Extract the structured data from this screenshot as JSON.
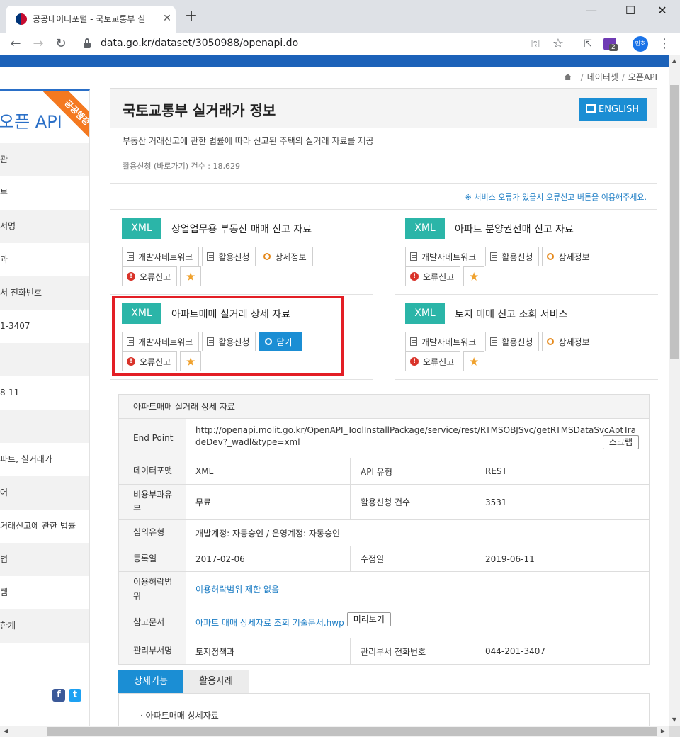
{
  "browser": {
    "tab_title": "공공데이터포털 - 국토교통부 실",
    "url": "data.go.kr/dataset/3050988/openapi.do",
    "extension_badge": "2",
    "profile_label": "민호"
  },
  "breadcrumb": {
    "item1": "데이터셋",
    "item2": "오픈API"
  },
  "sidebar": {
    "title": "오픈 API",
    "ribbon": "공공행정",
    "rows": [
      "관",
      "부",
      "서명",
      "과",
      "서 전화번호",
      "1-3407",
      "",
      "8-11",
      "",
      "파트, 실거래가",
      "어",
      "거래신고에 관한 법률",
      "법",
      "템",
      "한계"
    ]
  },
  "header": {
    "title": "국토교통부 실거래가 정보",
    "english_button": "ENGLISH",
    "description": "부동산 거래신고에 관한 법률에 따라 신고된 주택의 실거래 자료를 제공",
    "usage": "활용신청 (바로가기) 건수 : 18,629",
    "notice": "※ 서비스 오류가 있을시 오류신고 버튼을 이용해주세요."
  },
  "services": [
    {
      "type": "XML",
      "name": "상업업무용 부동산 매매 신고 자료",
      "btn_network": "개발자네트워크",
      "btn_apply": "활용신청",
      "btn_detail": "상세정보",
      "btn_error": "오류신고"
    },
    {
      "type": "XML",
      "name": "아파트 분양권전매 신고 자료",
      "btn_network": "개발자네트워크",
      "btn_apply": "활용신청",
      "btn_detail": "상세정보",
      "btn_error": "오류신고"
    },
    {
      "type": "XML",
      "name": "아파트매매 실거래 상세 자료",
      "btn_network": "개발자네트워크",
      "btn_apply": "활용신청",
      "btn_detail": "닫기",
      "btn_error": "오류신고"
    },
    {
      "type": "XML",
      "name": "토지 매매 신고 조회 서비스",
      "btn_network": "개발자네트워크",
      "btn_apply": "활용신청",
      "btn_detail": "상세정보",
      "btn_error": "오류신고"
    }
  ],
  "detail": {
    "title": "아파트매매 실거래 상세 자료",
    "endpoint_label": "End Point",
    "endpoint_value": "http://openapi.molit.go.kr/OpenAPI_ToolInstallPackage/service/rest/RTMSOBJSvc/getRTMSDataSvcAptTradeDev?_wadl&type=xml",
    "scrap_button": "스크랩",
    "format_label": "데이터포맷",
    "format_value": "XML",
    "api_type_label": "API 유형",
    "api_type_value": "REST",
    "fee_label": "비용부과유무",
    "fee_value": "무료",
    "apply_count_label": "활용신청 건수",
    "apply_count_value": "3531",
    "review_label": "심의유형",
    "review_value": "개발계정: 자동승인 / 운영계정: 자동승인",
    "reg_label": "등록일",
    "reg_value": "2017-02-06",
    "mod_label": "수정일",
    "mod_value": "2019-06-11",
    "license_label": "이용허락범위",
    "license_value": "이용허락범위 제한 없음",
    "ref_label": "참고문서",
    "ref_value": "아파트 매매 상세자료 조회 기술문서.hwp",
    "preview_button": "미리보기",
    "dept_label": "관리부서명",
    "dept_value": "토지정책과",
    "phone_label": "관리부서 전화번호",
    "phone_value": "044-201-3407"
  },
  "tabs": {
    "active": "상세기능",
    "inactive": "활용사례",
    "panel_item": "· 아파트매매 상세자료"
  },
  "colors": {
    "accent": "#1b8ed4",
    "xml_badge": "#2bb5a8",
    "highlight": "#e31e25",
    "ribbon": "#f47920"
  }
}
